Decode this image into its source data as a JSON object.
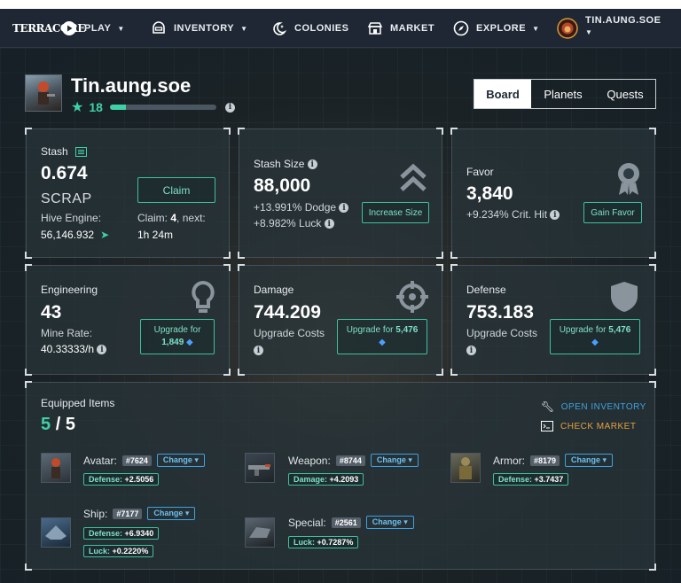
{
  "nav": {
    "logo": "TERRACORE",
    "play": "PLAY",
    "inventory": "INVENTORY",
    "colonies": "COLONIES",
    "market": "MARKET",
    "explore": "EXPLORE",
    "username": "TIN.AUNG.SOE"
  },
  "profile": {
    "name": "Tin.aung.soe",
    "level": "18",
    "progress": 0.15
  },
  "tabs": [
    "Board",
    "Planets",
    "Quests"
  ],
  "stash": {
    "label": "Stash",
    "value": "0.674",
    "unit": "SCRAP",
    "hive_label": "Hive Engine:",
    "hive_value": "56,146.932",
    "claim_button": "Claim",
    "claim_count_label": "Claim:",
    "claim_count": "4",
    "next_label": ", next:",
    "next_time": "1h 24m"
  },
  "stash_size": {
    "label": "Stash Size",
    "value": "88,000",
    "dodge": "+13.991% Dodge",
    "luck": "+8.982% Luck",
    "button": "Increase Size"
  },
  "favor": {
    "label": "Favor",
    "value": "3,840",
    "crit": "+9.234% Crit. Hit",
    "button": "Gain Favor"
  },
  "engineering": {
    "label": "Engineering",
    "value": "43",
    "rate_label": "Mine Rate:",
    "rate": "40.33333/h",
    "button_line1": "Upgrade for",
    "button_amount": "1,849"
  },
  "damage": {
    "label": "Damage",
    "value": "744.209",
    "costs": "Upgrade Costs",
    "button_text": "Upgrade for",
    "button_amount": "5,476"
  },
  "defense": {
    "label": "Defense",
    "value": "753.183",
    "costs": "Upgrade Costs",
    "button_text": "Upgrade for",
    "button_amount": "5,476"
  },
  "equipped": {
    "title": "Equipped Items",
    "count": "5",
    "sep": "/",
    "total": "5",
    "open_inventory": "OPEN INVENTORY",
    "check_market": "CHECK MARKET",
    "change": "Change",
    "avatar": {
      "label": "Avatar:",
      "id": "#7624",
      "stat_name": "Defense:",
      "stat_value": "+2.5056"
    },
    "weapon": {
      "label": "Weapon:",
      "id": "#8744",
      "stat_name": "Damage:",
      "stat_value": "+4.2093"
    },
    "armor": {
      "label": "Armor:",
      "id": "#8179",
      "stat_name": "Defense:",
      "stat_value": "+3.7437"
    },
    "ship": {
      "label": "Ship:",
      "id": "#7177",
      "stat1_name": "Defense:",
      "stat1_value": "+6.9340",
      "stat2_name": "Luck:",
      "stat2_value": "+0.2220%"
    },
    "special": {
      "label": "Special:",
      "id": "#2561",
      "stat_name": "Luck:",
      "stat_value": "+0.7287%"
    }
  },
  "colors": {
    "accent": "#3fbfa0",
    "link_blue": "#3ea2e0",
    "market_orange": "#e8a040",
    "topbar": "#1e2733"
  }
}
